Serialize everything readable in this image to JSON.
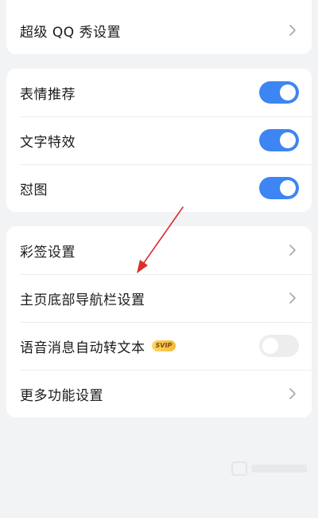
{
  "section1": {
    "items": [
      {
        "label": "超级 QQ 秀设置"
      }
    ]
  },
  "section2": {
    "items": [
      {
        "label": "表情推荐",
        "toggle_on": true
      },
      {
        "label": "文字特效",
        "toggle_on": true
      },
      {
        "label": "怼图",
        "toggle_on": true
      }
    ]
  },
  "section3": {
    "items": [
      {
        "label": "彩签设置"
      },
      {
        "label": "主页底部导航栏设置"
      },
      {
        "label": "语音消息自动转文本",
        "badge": "SVIP",
        "toggle_on": false
      },
      {
        "label": "更多功能设置"
      }
    ]
  },
  "colors": {
    "toggle_on": "#3d85f2",
    "toggle_off": "#ededed",
    "annotation_arrow": "#d9302c",
    "background": "#f2f3f5"
  },
  "icons": {
    "row_chevron": "chevron-right-icon",
    "annotation": "red-arrow-annotation",
    "watermark": "watermark-logo"
  }
}
